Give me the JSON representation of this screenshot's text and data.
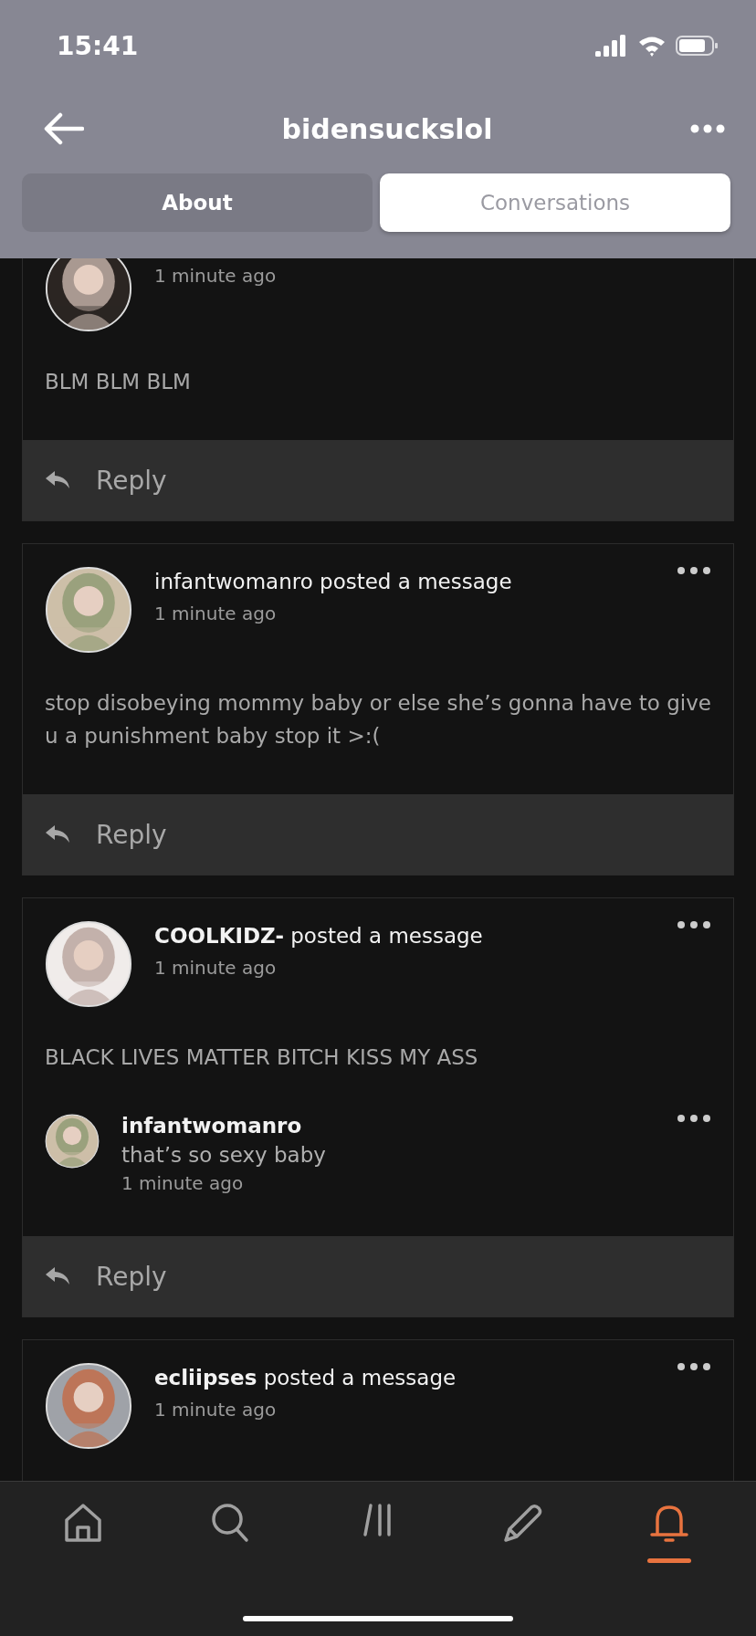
{
  "status_bar": {
    "time": "15:41"
  },
  "header": {
    "title": "bidensuckslol"
  },
  "tabs": [
    {
      "label": "About",
      "selected": false
    },
    {
      "label": "Conversations",
      "selected": true
    }
  ],
  "posts": [
    {
      "time": "1 minute ago",
      "message": "BLM BLM BLM",
      "reply_label": "Reply"
    },
    {
      "title": "infantwomanro posted a message",
      "time": "1 minute ago",
      "message": "stop disobeying mommy baby or else she’s gonna have to give u a punishment baby stop it >:(",
      "reply_label": "Reply"
    },
    {
      "title": "**COOLKIDZ-** posted a message",
      "time": "1 minute ago",
      "message": "BLACK LIVES MATTER BITCH KISS MY ASS",
      "replies": [
        {
          "author": "infantwomanro",
          "text": "that’s so sexy baby",
          "time": "1 minute ago"
        }
      ],
      "reply_label": "Reply"
    },
    {
      "title": "**ecliipses** posted a message",
      "time": "1 minute ago"
    }
  ],
  "nav": [
    {
      "kind": "home",
      "selected": false
    },
    {
      "kind": "search",
      "selected": false
    },
    {
      "kind": "feed",
      "selected": false
    },
    {
      "kind": "compose",
      "selected": false
    },
    {
      "kind": "bell",
      "selected": true
    }
  ]
}
